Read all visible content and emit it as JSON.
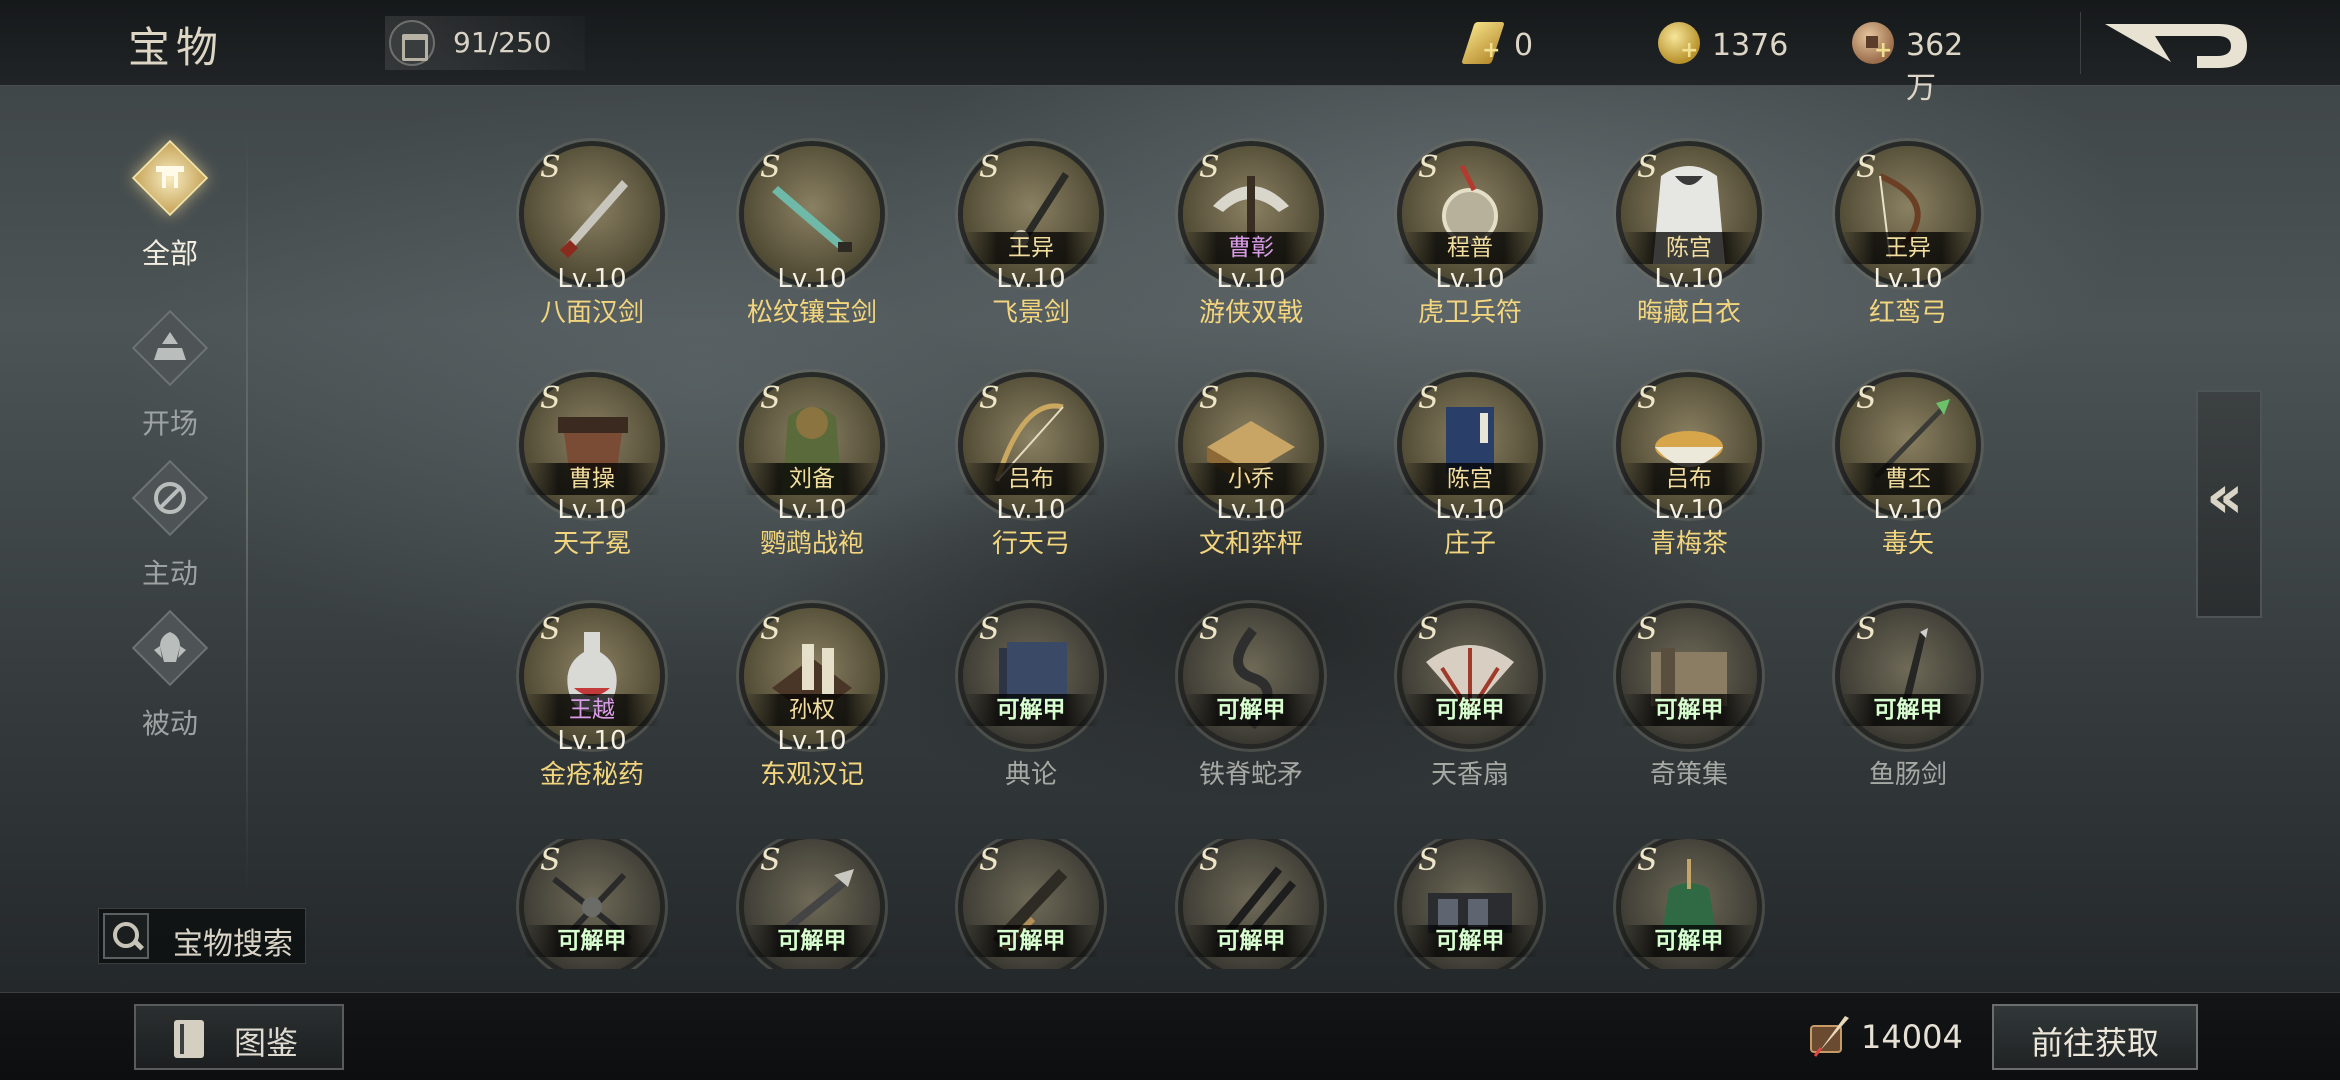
{
  "header": {
    "title": "宝物",
    "capacity": "91/250",
    "currencies": [
      {
        "icon": "gold-bar-icon",
        "value": "0"
      },
      {
        "icon": "yuanbao-coin-icon",
        "value": "1376"
      },
      {
        "icon": "copper-coin-icon",
        "value": "362万"
      }
    ],
    "back_icon": "back-arrow-icon"
  },
  "sidebar": {
    "items": [
      {
        "label": "全部",
        "icon": "all-treasure-icon",
        "active": true
      },
      {
        "label": "开场",
        "icon": "opening-icon",
        "active": false
      },
      {
        "label": "主动",
        "icon": "active-skill-icon",
        "active": false
      },
      {
        "label": "被动",
        "icon": "passive-skill-icon",
        "active": false
      }
    ],
    "search_label": "宝物搜索"
  },
  "treasures": [
    {
      "rank": "S",
      "owner": "",
      "level": "Lv.10",
      "name": "八面汉剑"
    },
    {
      "rank": "S",
      "owner": "",
      "level": "Lv.10",
      "name": "松纹镶宝剑"
    },
    {
      "rank": "S",
      "owner": "王异",
      "level": "Lv.10",
      "name": "飞景剑"
    },
    {
      "rank": "S",
      "owner": "曹彰",
      "level": "Lv.10",
      "name": "游侠双戟"
    },
    {
      "rank": "S",
      "owner": "程普",
      "level": "Lv.10",
      "name": "虎卫兵符"
    },
    {
      "rank": "S",
      "owner": "陈宫",
      "level": "Lv.10",
      "name": "晦藏白衣"
    },
    {
      "rank": "S",
      "owner": "王异",
      "level": "Lv.10",
      "name": "红鸾弓"
    },
    {
      "rank": "S",
      "owner": "曹操",
      "level": "Lv.10",
      "name": "天子冕"
    },
    {
      "rank": "S",
      "owner": "刘备",
      "level": "Lv.10",
      "name": "鹦鹉战袍"
    },
    {
      "rank": "S",
      "owner": "吕布",
      "level": "Lv.10",
      "name": "行天弓"
    },
    {
      "rank": "S",
      "owner": "小乔",
      "level": "Lv.10",
      "name": "文和弈枰"
    },
    {
      "rank": "S",
      "owner": "陈宫",
      "level": "Lv.10",
      "name": "庄子"
    },
    {
      "rank": "S",
      "owner": "吕布",
      "level": "Lv.10",
      "name": "青梅茶"
    },
    {
      "rank": "S",
      "owner": "曹丕",
      "level": "Lv.10",
      "name": "毒矢"
    },
    {
      "rank": "S",
      "owner": "王越",
      "level": "Lv.10",
      "name": "金疮秘药"
    },
    {
      "rank": "S",
      "owner": "孙权",
      "level": "Lv.10",
      "name": "东观汉记"
    },
    {
      "rank": "S",
      "owner": "可解甲",
      "level": "",
      "name": "典论"
    },
    {
      "rank": "S",
      "owner": "可解甲",
      "level": "",
      "name": "铁脊蛇矛"
    },
    {
      "rank": "S",
      "owner": "可解甲",
      "level": "",
      "name": "天香扇"
    },
    {
      "rank": "S",
      "owner": "可解甲",
      "level": "",
      "name": "奇策集"
    },
    {
      "rank": "S",
      "owner": "可解甲",
      "level": "",
      "name": "鱼肠剑"
    },
    {
      "rank": "S",
      "owner": "可解甲",
      "level": "",
      "name": ""
    },
    {
      "rank": "S",
      "owner": "可解甲",
      "level": "",
      "name": ""
    },
    {
      "rank": "S",
      "owner": "可解甲",
      "level": "",
      "name": ""
    },
    {
      "rank": "S",
      "owner": "可解甲",
      "level": "",
      "name": ""
    },
    {
      "rank": "S",
      "owner": "可解甲",
      "level": "",
      "name": ""
    },
    {
      "rank": "S",
      "owner": "可解甲",
      "level": "",
      "name": ""
    }
  ],
  "footer": {
    "catalog_label": "图鉴",
    "shard_value": "14004",
    "obtain_label": "前往获取"
  },
  "colors": {
    "accent_gold": "#f2d57c",
    "owner_gold": "#f1dd9e",
    "owner_purple": "#d99be8",
    "unequipped_gray": "#a6a8a4"
  }
}
